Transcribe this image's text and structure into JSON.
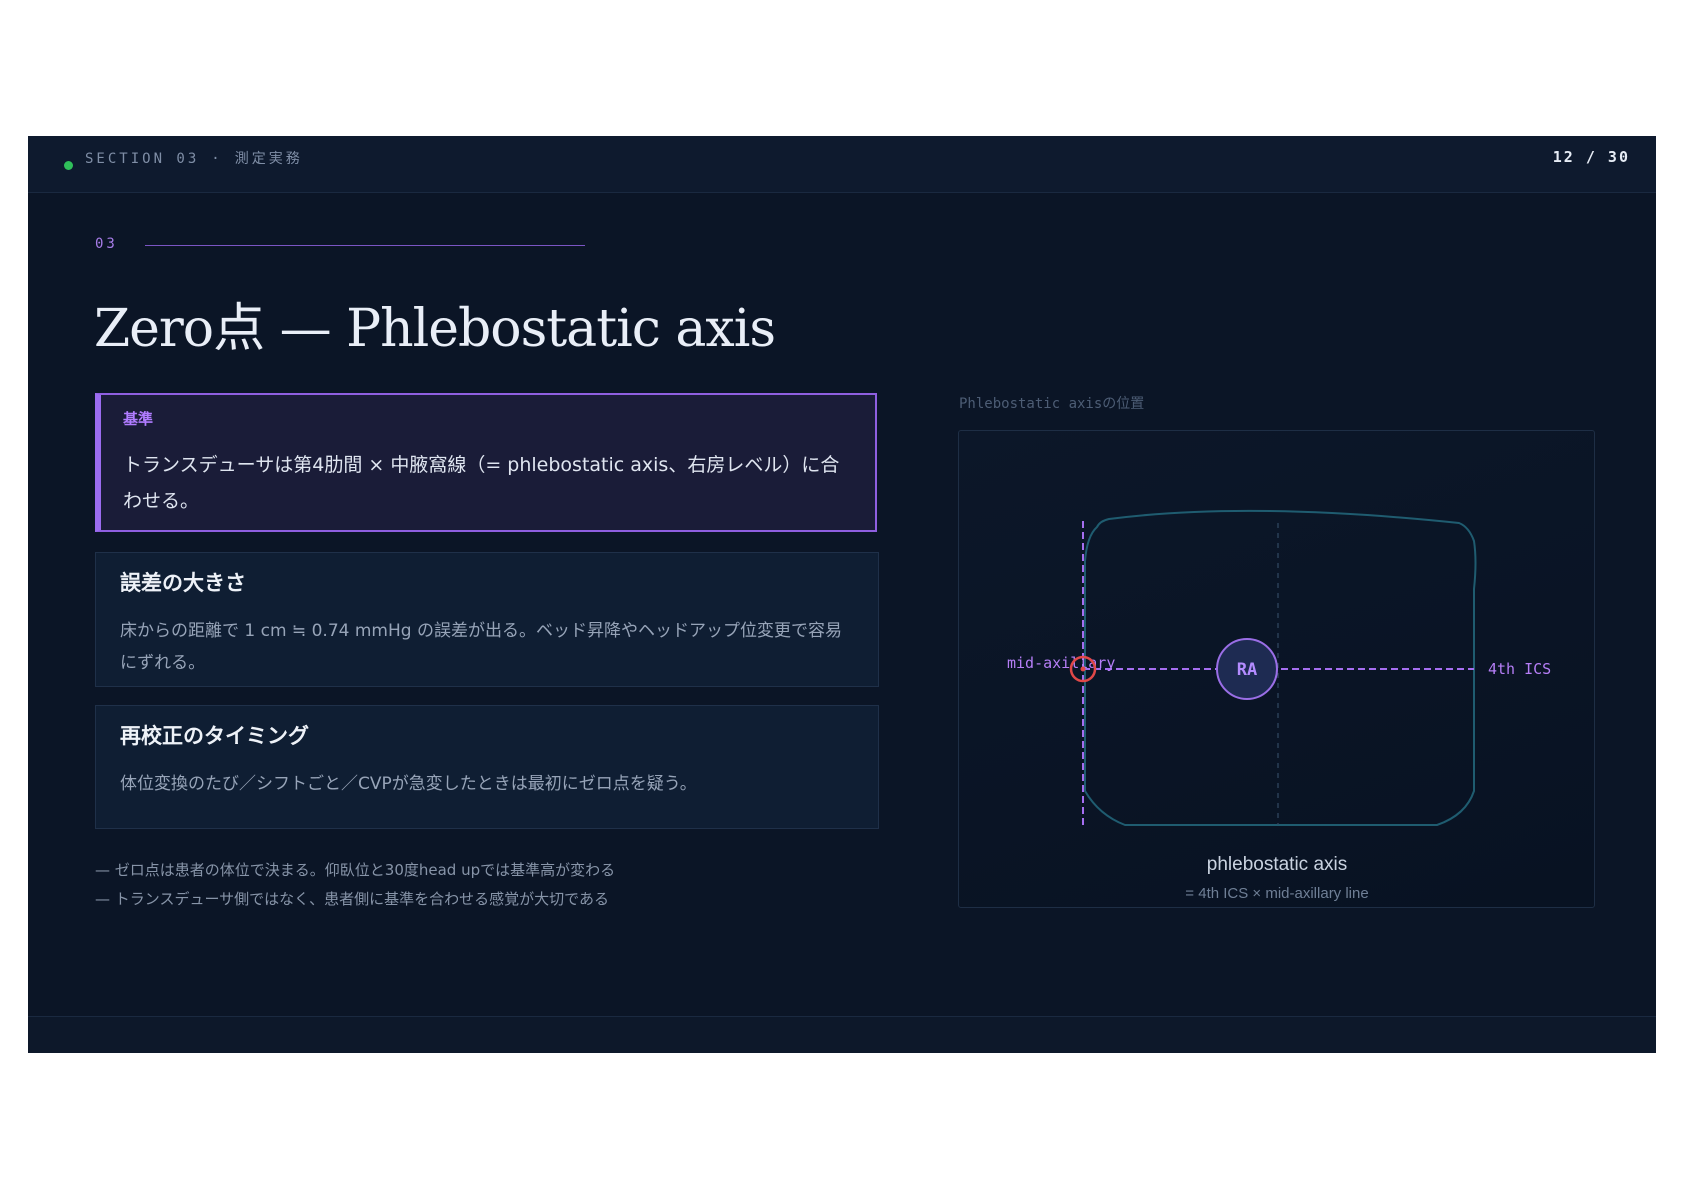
{
  "header": {
    "section": "SECTION 03",
    "separator": "·",
    "section_title": "測定実務",
    "page": "12 / 30"
  },
  "slide": {
    "number": "03",
    "title": "Zero点 — Phlebostatic axis"
  },
  "callout": {
    "label": "基準",
    "text": "トランスデューサは第4肋間 × 中腋窩線（= phlebostatic axis、右房レベル）に合わせる。"
  },
  "cards": [
    {
      "title": "誤差の大きさ",
      "text": "床からの距離で 1 cm ≒ 0.74 mmHg の誤差が出る。ベッド昇降やヘッドアップ位変更で容易にずれる。"
    },
    {
      "title": "再校正のタイミング",
      "text": "体位変換のたび／シフトごと／CVPが急変したときは最初にゼロ点を疑う。"
    }
  ],
  "notes": [
    "— ゼロ点は患者の体位で決まる。仰臥位と30度head upでは基準高が変わる",
    "— トランスデューサ側ではなく、患者側に基準を合わせる感覚が大切である"
  ],
  "figure": {
    "caption": "Phlebostatic axisの位置",
    "label_left": "mid-axillary",
    "label_right": "4th ICS",
    "center_label": "RA",
    "title": "phlebostatic axis",
    "subtitle": "= 4th ICS × mid-axillary line"
  },
  "colors": {
    "background": "#0b1526",
    "accent_purple": "#9b6cf0",
    "status_green": "#2fbf5a",
    "marker_red": "#e04848",
    "torso_outline": "#1f5c70"
  }
}
